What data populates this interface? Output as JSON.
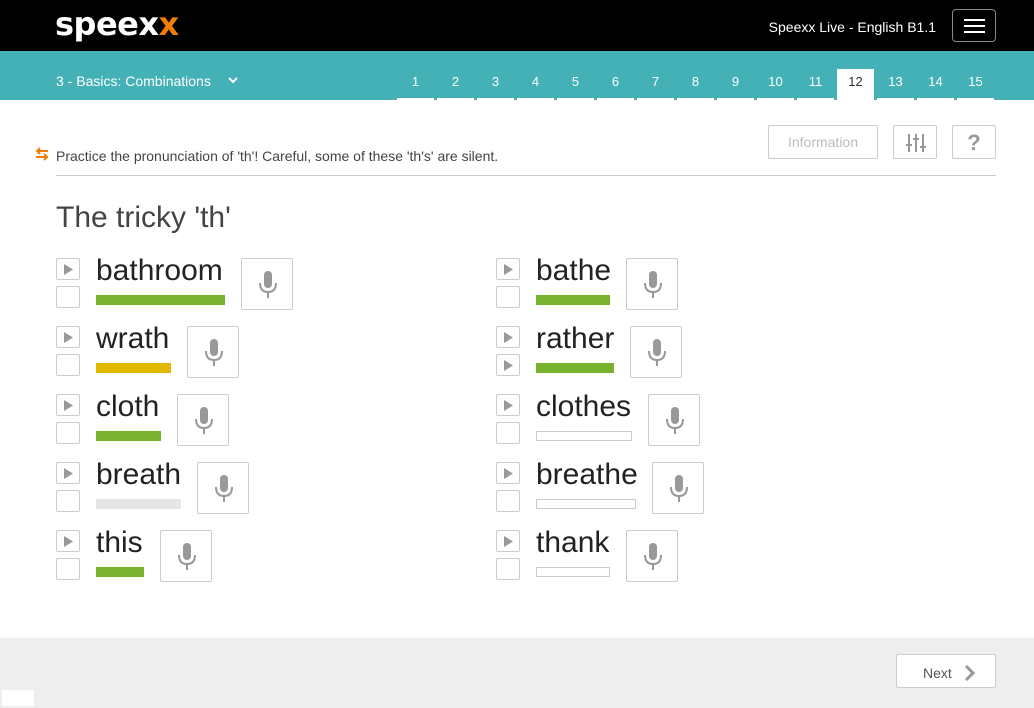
{
  "header": {
    "logo_main": "speex",
    "logo_accent": "x",
    "course_title": "Speexx Live - English B1.1",
    "menu_icon": "hamburger-icon"
  },
  "nav": {
    "lesson": "3 - Basics: Combinations",
    "pages": [
      "1",
      "2",
      "3",
      "4",
      "5",
      "6",
      "7",
      "8",
      "9",
      "10",
      "11",
      "12",
      "13",
      "14",
      "15"
    ],
    "active_page": "12"
  },
  "toolbar": {
    "instruction": "Practice the pronunciation of 'th'! Careful, some of these 'th's' are silent.",
    "information_label": "Information",
    "settings_icon": "sliders-icon",
    "help_label": "?"
  },
  "exercise": {
    "title": "The tricky 'th'",
    "left_column": [
      {
        "word": "bathroom",
        "score": "good"
      },
      {
        "word": "wrath",
        "score": "mid"
      },
      {
        "word": "cloth",
        "score": "good"
      },
      {
        "word": "breath",
        "score": "none"
      },
      {
        "word": "this",
        "score": "good"
      }
    ],
    "right_column": [
      {
        "word": "bathe",
        "score": "good"
      },
      {
        "word": "rather",
        "score": "good",
        "recording_playable": true
      },
      {
        "word": "clothes",
        "score": "empty"
      },
      {
        "word": "breathe",
        "score": "empty"
      },
      {
        "word": "thank",
        "score": "empty"
      }
    ]
  },
  "footer": {
    "next_label": "Next"
  },
  "colors": {
    "topbar": "#000000",
    "navbar": "#43b1b5",
    "accent_logo": "#f07d00",
    "score_good": "#78b22e",
    "score_mid": "#e3b800"
  }
}
